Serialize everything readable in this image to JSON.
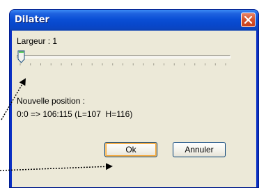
{
  "window": {
    "title": "Dilater"
  },
  "slider": {
    "label": "Largeur : 1",
    "value": 1,
    "min": 1,
    "tick_count": 21
  },
  "position": {
    "heading": "Nouvelle position :",
    "text": "0:0 => 106:115 (L=107  H=116)"
  },
  "buttons": {
    "ok_label": "Ok",
    "cancel_label": "Annuler"
  },
  "icons": {
    "close": "close-icon",
    "thumb": "slider-thumb-icon"
  },
  "colors": {
    "titlebar": "#0a4fd6",
    "client": "#ece9d8",
    "close": "#d6552f",
    "ok_focus": "#f5a739"
  }
}
